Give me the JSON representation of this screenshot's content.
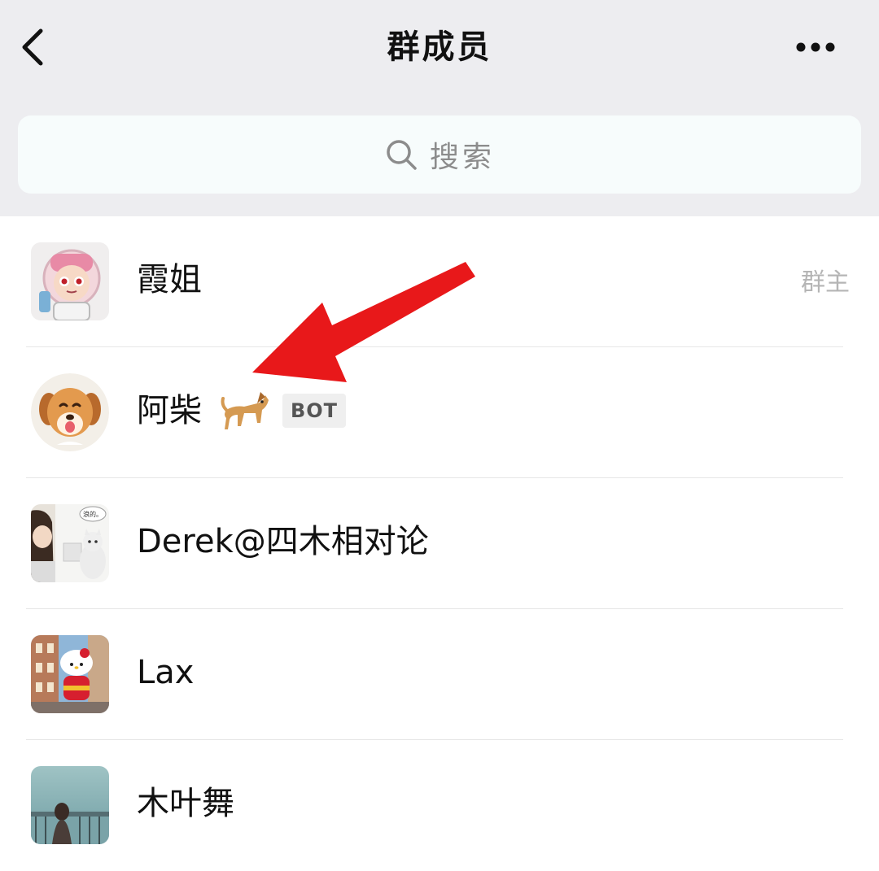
{
  "header": {
    "title": "群成员",
    "back_icon": "chevron-left-icon",
    "more_icon": "more-dots-icon"
  },
  "search": {
    "label": "搜索",
    "icon": "search-icon"
  },
  "members": [
    {
      "name": "霞姐",
      "tag": "群主",
      "avatar": "astronaut-girl-avatar"
    },
    {
      "name": "阿柴",
      "badge": "BOT",
      "emoji": "dog-emoji",
      "avatar": "shiba-dog-avatar"
    },
    {
      "name": "Derek@四木相对论",
      "avatar": "girl-and-cat-avatar",
      "avatar_bubble_text": "浪的。"
    },
    {
      "name": "Lax",
      "avatar": "hello-kitty-street-avatar"
    },
    {
      "name": "木叶舞",
      "avatar": "girl-by-railing-avatar"
    }
  ],
  "annotation": {
    "arrow_color": "#e8181a"
  },
  "colors": {
    "header_bg": "#ededf0",
    "search_bg": "#f7fcfc",
    "list_bg": "#ffffff",
    "owner_tag": "#b5b5b5",
    "bot_badge_bg": "#efefef",
    "divider": "#e6e6e6"
  }
}
